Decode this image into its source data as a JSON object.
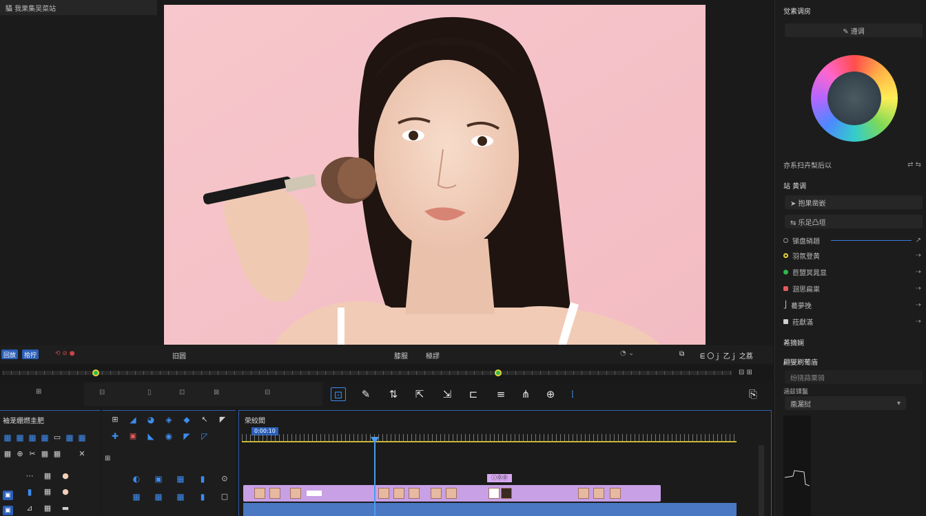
{
  "top_left": {
    "label": "䯀 我果集吴菜站"
  },
  "right_panel": {
    "section1_title": "觉素调房",
    "dropdown1": "✎ 遵调",
    "row_under_wheel": "亦系扫卉梨后以",
    "section2_title": "站 黄调",
    "btn1": "➤ 抱果凿嵌",
    "btn2": "⇆ 乐足凸垣",
    "rows": [
      {
        "label": "锑盘硝趙",
        "dot": "#3a3a3a"
      },
      {
        "label": "羽氛登黄",
        "dot": "#e6d53a"
      },
      {
        "label": "苣盟冥晁显",
        "dot": "#2fb84a"
      },
      {
        "label": "洄思扁粜",
        "dot": "#e65a5a"
      },
      {
        "label": "驀夢挽",
        "dot": "#3a3a3a"
      },
      {
        "label": "菈獻滿",
        "dot": "#cfcfcf"
      }
    ],
    "section3_title": "莃摘娴",
    "section4_title": "翩燮刷葡庙",
    "field1": "纷挠蒜栗骑",
    "section5_title": "涵兹锞鬣",
    "select1": "凰漏挝"
  },
  "transport": {
    "btn_a": "回放",
    "btn_b": "拾拧",
    "center_left": "膝服",
    "center_label": "極謬",
    "timecode": "ᗴ 〇ｊ 乙ｊ 之荔",
    "mid_label": "旧圆"
  },
  "media_panel": {
    "title": "袖茏绷燃圭肥"
  },
  "timeline": {
    "title": "荣絞閻",
    "timecode": "0:00:10",
    "clip_label": "ⓘ⓪⓪"
  }
}
